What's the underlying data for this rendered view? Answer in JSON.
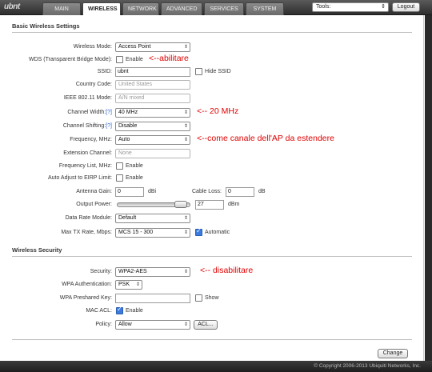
{
  "nav": {
    "logo": "ubnt",
    "tabs": [
      "MAIN",
      "WIRELESS",
      "NETWORK",
      "ADVANCED",
      "SERVICES",
      "SYSTEM"
    ],
    "active_tab": "WIRELESS",
    "tools_label": "Tools:",
    "logout_label": "Logout"
  },
  "basic": {
    "title": "Basic Wireless Settings",
    "wireless_mode_label": "Wireless Mode:",
    "wireless_mode_value": "Access Point",
    "wds_label": "WDS (Transparent Bridge Mode):",
    "wds_enable_label": "Enable",
    "wds_enabled": false,
    "ssid_label": "SSID:",
    "ssid_value": "ubnt",
    "hide_ssid_label": "Hide SSID",
    "country_label": "Country Code:",
    "country_value": "United States",
    "ieee_label": "IEEE 802.11 Mode:",
    "ieee_value": "A/N mixed",
    "channel_width_label": "Channel Width:",
    "channel_width_help": "[?]",
    "channel_width_value": "40 MHz",
    "channel_shifting_label": "Channel Shifting:",
    "channel_shifting_help": "[?]",
    "channel_shifting_value": "Disable",
    "frequency_label": "Frequency, MHz:",
    "frequency_value": "Auto",
    "ext_channel_label": "Extension Channel:",
    "ext_channel_value": "None",
    "freq_list_label": "Frequency List, MHz:",
    "freq_list_enable_label": "Enable",
    "auto_eirp_label": "Auto Adjust to EIRP Limit:",
    "auto_eirp_enable_label": "Enable",
    "antenna_gain_label": "Antenna Gain:",
    "antenna_gain_value": "0",
    "antenna_gain_unit": "dBi",
    "cable_loss_label": "Cable Loss:",
    "cable_loss_value": "0",
    "cable_loss_unit": "dB",
    "output_power_label": "Output Power:",
    "output_power_value": "27",
    "output_power_unit": "dBm",
    "output_power_level": 0.95,
    "data_rate_label": "Data Rate Module:",
    "data_rate_value": "Default",
    "max_tx_label": "Max TX Rate, Mbps:",
    "max_tx_value": "MCS 15 - 300",
    "automatic_label": "Automatic",
    "automatic_checked": true
  },
  "security": {
    "title": "Wireless Security",
    "security_label": "Security:",
    "security_value": "WPA2-AES",
    "wpa_auth_label": "WPA Authentication:",
    "wpa_auth_value": "PSK",
    "wpa_key_label": "WPA Preshared Key:",
    "wpa_key_value": "",
    "show_label": "Show",
    "mac_acl_label": "MAC ACL:",
    "mac_acl_enable_label": "Enable",
    "mac_acl_checked": true,
    "policy_label": "Policy:",
    "policy_value": "Allow",
    "acl_button": "ACL..."
  },
  "notes": {
    "wds": "<--abilitare",
    "channel_width": "<-- 20 MHz",
    "frequency": "<--come canale dell'AP da estendere",
    "security": "<-- disabilitare"
  },
  "change_button": "Change",
  "copyright": "© Copyright 2006-2013 Ubiquiti Networks, Inc."
}
